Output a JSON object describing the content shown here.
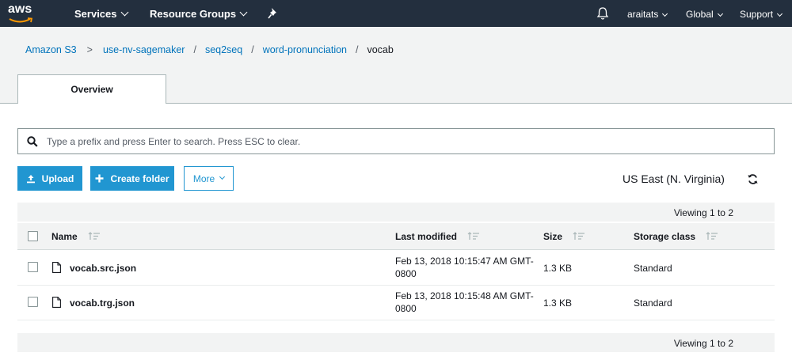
{
  "nav": {
    "logo": "aws",
    "services": "Services",
    "resource_groups": "Resource Groups",
    "user": "araitats",
    "region": "Global",
    "support": "Support"
  },
  "breadcrumb": {
    "items": [
      "Amazon S3",
      "use-nv-sagemaker",
      "seq2seq",
      "word-pronunciation"
    ],
    "current": "vocab"
  },
  "tabs": {
    "overview": "Overview"
  },
  "search": {
    "placeholder": "Type a prefix and press Enter to search. Press ESC to clear.",
    "value": ""
  },
  "toolbar": {
    "upload": "Upload",
    "create_folder": "Create folder",
    "more": "More",
    "region": "US East (N. Virginia)"
  },
  "viewing": {
    "top": "Viewing 1 to 2",
    "bottom": "Viewing 1 to 2"
  },
  "table": {
    "headers": {
      "name": "Name",
      "modified": "Last modified",
      "size": "Size",
      "storage": "Storage class"
    },
    "rows": [
      {
        "name": "vocab.src.json",
        "modified_line1": "Feb 13, 2018 10:15:47 AM GMT-",
        "modified_line2": "0800",
        "size": "1.3 KB",
        "storage": "Standard"
      },
      {
        "name": "vocab.trg.json",
        "modified_line1": "Feb 13, 2018 10:15:48 AM GMT-",
        "modified_line2": "0800",
        "size": "1.3 KB",
        "storage": "Standard"
      }
    ]
  },
  "colors": {
    "nav_bg": "#232f3e",
    "primary": "#2196d1",
    "link": "#0073bb"
  }
}
